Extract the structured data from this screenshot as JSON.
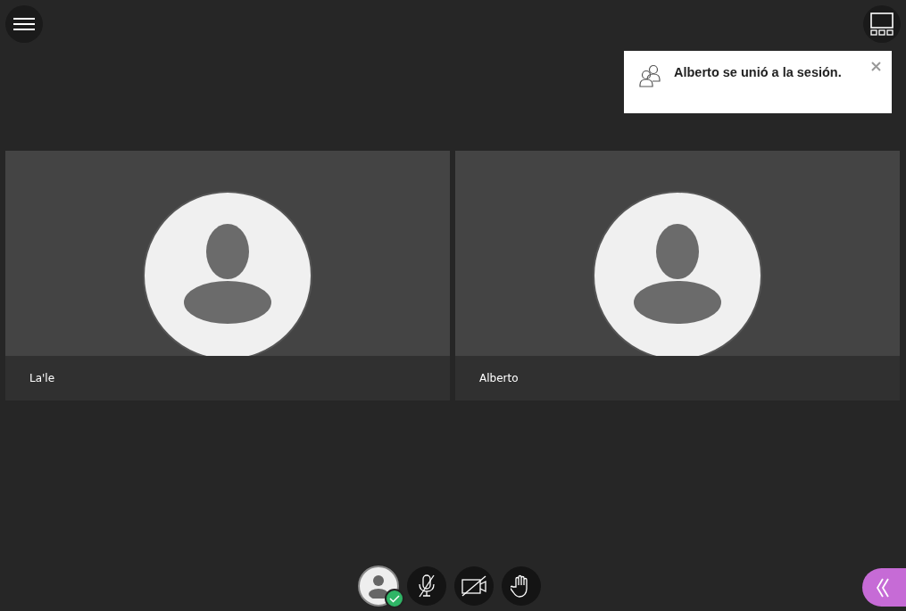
{
  "notification": {
    "message": "Alberto se unió a la sesión."
  },
  "participants": [
    {
      "name": "La'le"
    },
    {
      "name": "Alberto"
    }
  ],
  "controls": {
    "status_ok": true,
    "mic_muted": true,
    "camera_on": false,
    "hand_raised": false
  }
}
